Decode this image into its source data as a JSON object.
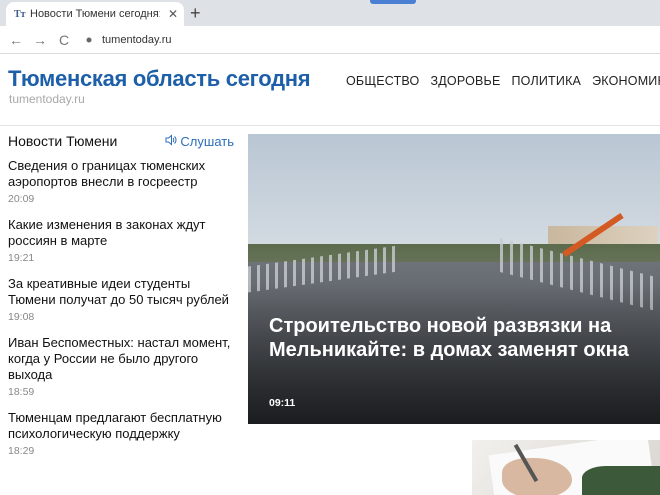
{
  "browser": {
    "tab_favicon": "Тт",
    "tab_title": "Новости Тюмени сегодня: посл",
    "tab_close": "✕",
    "new_tab": "+",
    "back": "←",
    "forward": "→",
    "reload": "C",
    "url": "tumentoday.ru"
  },
  "header": {
    "logo": "Тюменская область сегодня",
    "logo_sub": "tumentoday.ru",
    "nav": [
      "ОБЩЕСТВО",
      "ЗДОРОВЬЕ",
      "ПОЛИТИКА",
      "ЭКОНОМИКА"
    ]
  },
  "news": {
    "title": "Новости Тюмени",
    "listen_label": "Слушать",
    "items": [
      {
        "headline": "Сведения о границах тюменских аэропортов внесли в госреестр",
        "time": "20:09"
      },
      {
        "headline": "Какие изменения в законах ждут россиян в марте",
        "time": "19:21"
      },
      {
        "headline": "За креативные идеи студенты Тюмени получат до 50 тысяч рублей",
        "time": "19:08"
      },
      {
        "headline": "Иван Беспоместных: настал момент, когда у России не было другого выхода",
        "time": "18:59"
      },
      {
        "headline": "Тюменцам предлагают бесплатную психологическую поддержку",
        "time": "18:29"
      }
    ]
  },
  "hero": {
    "title": "Строительство новой развязки на Мельникайте: в домах заменят окна",
    "time": "09:11"
  },
  "colors": {
    "brand": "#1d5fa8",
    "link": "#2d6fb8"
  }
}
